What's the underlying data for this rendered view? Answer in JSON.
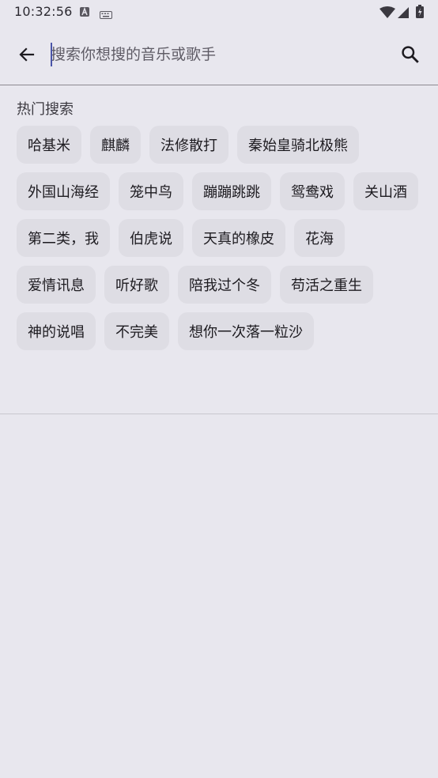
{
  "status_bar": {
    "time": "10:32:56"
  },
  "toolbar": {
    "search_placeholder": "搜索你想搜的音乐或歌手"
  },
  "hot_search": {
    "title": "热门搜索",
    "chips": [
      "哈基米",
      "麒麟",
      "法修散打",
      "秦始皇骑北极熊",
      "外国山海经",
      "笼中鸟",
      "蹦蹦跳跳",
      "鸳鸯戏",
      "关山酒",
      "第二类，我",
      "伯虎说",
      "天真的橡皮",
      "花海",
      "爱情讯息",
      "听好歌",
      "陪我过个冬",
      "苟活之重生",
      "神的说唱",
      "不完美",
      "想你一次落一粒沙"
    ]
  },
  "colors": {
    "background": "#e8e7ee",
    "chip_background": "#dedde4",
    "caret": "#4a55a8"
  }
}
